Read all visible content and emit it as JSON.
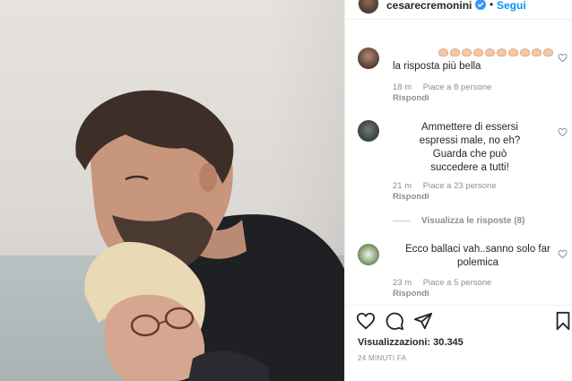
{
  "header": {
    "username": "cesarecremonini",
    "separator": "•",
    "follow_label": "Segui",
    "verified_icon": "verified-badge-icon"
  },
  "comments": [
    {
      "text": "la risposta più bella",
      "emoji_count": 10,
      "time": "18 m",
      "likes": "Piace a 8 persone",
      "reply": "Rispondi"
    },
    {
      "text": "Ammettere di essersi espressi male, no eh? Guarda che può succedere a tutti!",
      "time": "21 m",
      "likes": "Piace a 23 persone",
      "reply": "Rispondi",
      "view_replies": "Visualizza le risposte (8)"
    },
    {
      "text": "Ecco ballaci vah..sanno solo far polemica",
      "time": "23 m",
      "likes": "Piace a 5 persone",
      "reply": "Rispondi"
    }
  ],
  "footer": {
    "views": "Visualizzazioni: 30.345",
    "posted": "24 MINUTI FA",
    "icons": [
      "heart-icon",
      "comment-icon",
      "share-icon",
      "bookmark-icon"
    ]
  },
  "colors": {
    "link": "#0095f6",
    "text": "#262626",
    "muted": "#8e8e8e"
  }
}
